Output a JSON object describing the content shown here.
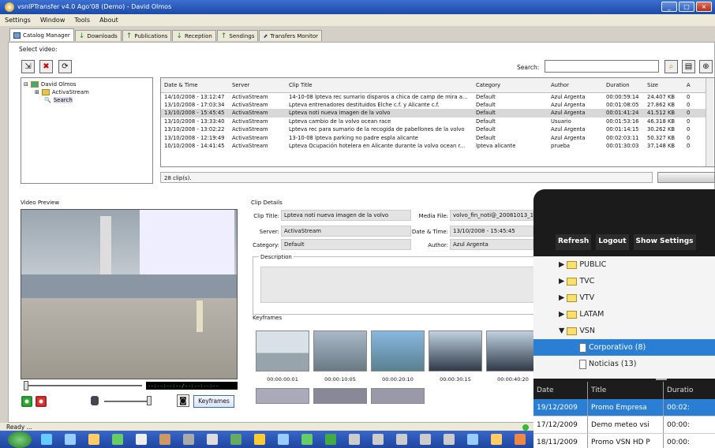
{
  "window": {
    "title": "vsnIPTransfer v4.0 Ago'08 (Demo) - David Olmos"
  },
  "menu": [
    "Settings",
    "Window",
    "Tools",
    "About"
  ],
  "tabs": [
    "Catalog Manager",
    "Downloads",
    "Publications",
    "Reception",
    "Sendings",
    "Transfers Monitor"
  ],
  "select_video_label": "Select video:",
  "tree": {
    "root": "David Olmos",
    "child": "ActivaStream",
    "search": "Search"
  },
  "search": {
    "label": "Search:",
    "value": ""
  },
  "table": {
    "columns": [
      "Date & Time",
      "Server",
      "Clip Title",
      "Category",
      "Author",
      "Duration",
      "Size",
      "A"
    ],
    "rows": [
      [
        "14/10/2008 - 13:12:47",
        "ActivaStream",
        "14-10-08 lpteva rec sumario disparos a chica de camp de mira a...",
        "Default",
        "Azul Argenta",
        "00:00:59:14",
        "24.407 KB",
        "0"
      ],
      [
        "13/10/2008 - 17:03:34",
        "ActivaStream",
        "Lpteva entrenadores destituidos Elche c.f. y Alicante c.f.",
        "Default",
        "Azul Argenta",
        "00:01:08:05",
        "27.862 KB",
        "0"
      ],
      [
        "13/10/2008 - 15:45:45",
        "ActivaStream",
        "Lpteva noti nueva imagen de la volvo",
        "Default",
        "Azul Argenta",
        "00:01:41:24",
        "41.512 KB",
        "0"
      ],
      [
        "13/10/2008 - 13:33:40",
        "ActivaStream",
        "Lpteva cambio de la volvo ocean race",
        "Default",
        "Usuario",
        "00:01:53:16",
        "46.318 KB",
        "0"
      ],
      [
        "13/10/2008 - 13:02:22",
        "ActivaStream",
        "Lpteva rec para sumario de la recogida de pabellones de la volvo",
        "Default",
        "Azul Argenta",
        "00:01:14:15",
        "30.262 KB",
        "0"
      ],
      [
        "13/10/2008 - 12:19:49",
        "ActivaStream",
        "13-10-08 lpteva parking no padre espla alicante",
        "Default",
        "Azul Argenta",
        "00:02:03:11",
        "50.327 KB",
        "0"
      ],
      [
        "10/10/2008 - 14:41:45",
        "ActivaStream",
        "Lpteva Ocupación hotelera en Alicante durante la volvo ocean r...",
        "lpteva alicante",
        "prueba",
        "00:01:30:03",
        "37.148 KB",
        "0"
      ]
    ]
  },
  "clip_count": "28 clip(s).",
  "video_preview": {
    "title": "Video Preview",
    "timecode": "--:--:--:--/--:--:--:--",
    "keyframes_button": "Keyframes"
  },
  "clip_details": {
    "title": "Clip Details",
    "clip_title_label": "Clip Title:",
    "clip_title": "Lpteva noti nueva imagen de la volvo",
    "server_label": "Server:",
    "server": "ActivaStream",
    "category_label": "Category:",
    "category": "Default",
    "media_file_label": "Media File:",
    "media_file": "volvo_fin_noti@_20081013_1",
    "date_label": "Date & Time:",
    "date": "13/10/2008 - 15:45:45",
    "author_label": "Author:",
    "author": "Azul Argenta",
    "description_label": "Description"
  },
  "keyframes": {
    "title": "Keyframes",
    "times": [
      "00:00:00:01",
      "00:00:10:05",
      "00:00:20:10",
      "00:00:30:15",
      "00:00:40:20"
    ]
  },
  "status": "Ready ...",
  "mobile": {
    "buttons": [
      "Refresh",
      "Logout",
      "Show Settings"
    ],
    "folders": [
      "PUBLIC",
      "TVC",
      "VTV",
      "LATAM",
      "VSN"
    ],
    "subitems": [
      "Corporativo (8)",
      "Noticias (13)"
    ],
    "columns": [
      "Date",
      "Title",
      "Duratio"
    ],
    "rows": [
      [
        "19/12/2009",
        "Promo Empresa",
        "00:02:"
      ],
      [
        "17/12/2009",
        "Demo meteo vsi",
        "00:00:"
      ],
      [
        "18/11/2009",
        "Promo VSN HD P",
        "00:00:"
      ]
    ]
  },
  "colors": {
    "accent": "#2a7fd4",
    "titlebar": "#2456b8"
  }
}
